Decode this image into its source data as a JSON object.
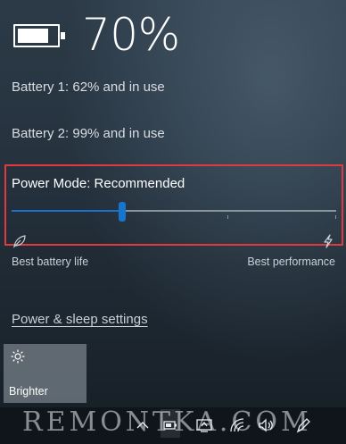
{
  "battery": {
    "percent_text": "70%",
    "percent_value": 0.7,
    "battery1_text": "Battery 1: 62% and in use",
    "battery2_text": "Battery 2: 99% and in use"
  },
  "power_mode": {
    "title": "Power Mode: Recommended",
    "slider_position": 0.34,
    "left_label": "Best battery life",
    "right_label": "Best performance",
    "left_icon": "leaf-battery-saver-icon",
    "right_icon": "lightning-performance-icon"
  },
  "settings_link": "Power & sleep settings",
  "quick_actions": [
    {
      "label": "Brighter",
      "icon": "sun-brightness-icon"
    }
  ],
  "taskbar": {
    "icons": [
      "chevron-up-icon",
      "battery-tray-icon",
      "project-display-icon",
      "wifi-icon",
      "volume-icon",
      "pen-icon"
    ]
  },
  "watermark_text": "REMONTKA.COM",
  "colors": {
    "accent": "#1875cf",
    "highlight_border": "#e0393e"
  }
}
